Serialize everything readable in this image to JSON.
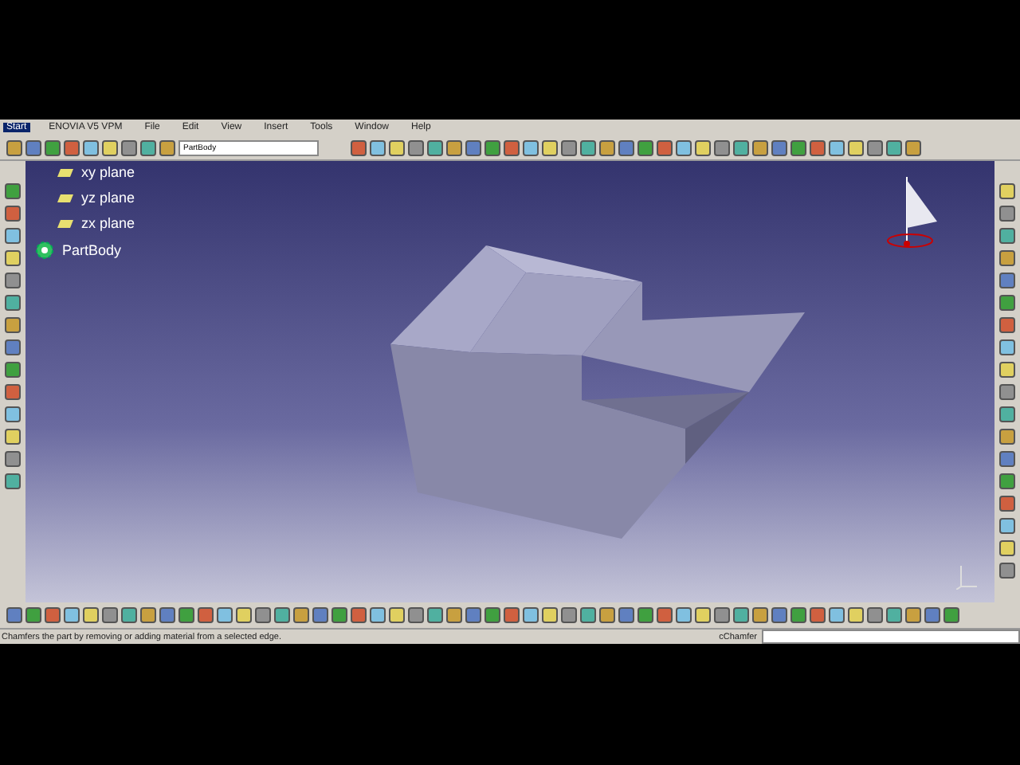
{
  "menu": [
    {
      "label": "Start",
      "selected": true
    },
    {
      "label": "ENOVIA V5 VPM",
      "selected": false
    },
    {
      "label": "File",
      "selected": false
    },
    {
      "label": "Edit",
      "selected": false
    },
    {
      "label": "View",
      "selected": false
    },
    {
      "label": "Insert",
      "selected": false
    },
    {
      "label": "Tools",
      "selected": false
    },
    {
      "label": "Window",
      "selected": false
    },
    {
      "label": "Help",
      "selected": false
    }
  ],
  "body_selector": {
    "value": "PartBody"
  },
  "tree": [
    {
      "label": "xy plane",
      "kind": "plane"
    },
    {
      "label": "yz plane",
      "kind": "plane"
    },
    {
      "label": "zx plane",
      "kind": "plane"
    },
    {
      "label": "PartBody",
      "kind": "body"
    }
  ],
  "status_bar": {
    "message": "Chamfers the part by removing or adding material from a selected edge.",
    "command": "cChamfer"
  }
}
